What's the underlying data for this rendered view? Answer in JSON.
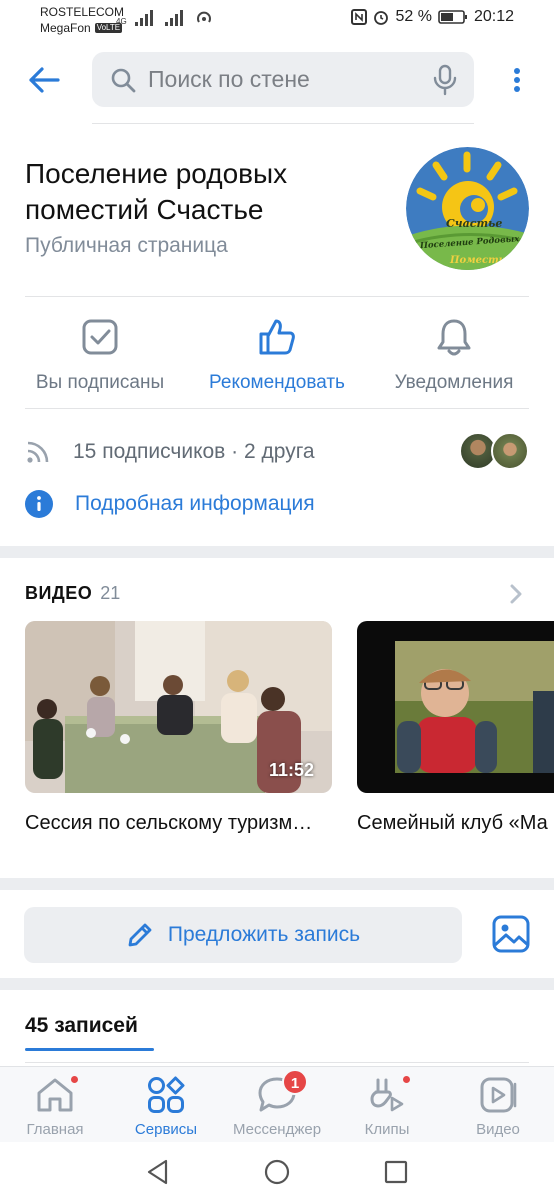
{
  "status_bar": {
    "carrier1": "ROSTELECOM",
    "carrier2": "MegaFon",
    "volte": "VoLTE",
    "net_type": "4G",
    "battery": "52 %",
    "time": "20:12"
  },
  "header": {
    "search_placeholder": "Поиск по стене"
  },
  "group": {
    "title": "Поселение родовых поместий Счастье",
    "type": "Публичная страница",
    "avatar_text_top": "Счастье",
    "avatar_text_mid": "Поселение Родовых",
    "avatar_text_bottom": "Поместий"
  },
  "actions": {
    "subscribed": "Вы подписаны",
    "recommend": "Рекомендовать",
    "notifications": "Уведомления"
  },
  "subscribers": {
    "text": "15 подписчиков · 2 друга",
    "details": "Подробная информация"
  },
  "video": {
    "header": "ВИДЕО",
    "count": "21",
    "items": [
      {
        "title": "Сессия по сельскому туризм…",
        "duration": "11:52"
      },
      {
        "title": "Семейный клуб «Ма"
      }
    ]
  },
  "post": {
    "propose": "Предложить запись",
    "count": "45 записей"
  },
  "tabs": {
    "home": "Главная",
    "services": "Сервисы",
    "messenger": "Мессенджер",
    "messenger_badge": "1",
    "clips": "Клипы",
    "video": "Видео"
  },
  "colors": {
    "accent": "#2b7bd8",
    "muted": "#818c99",
    "badge": "#e64646"
  }
}
